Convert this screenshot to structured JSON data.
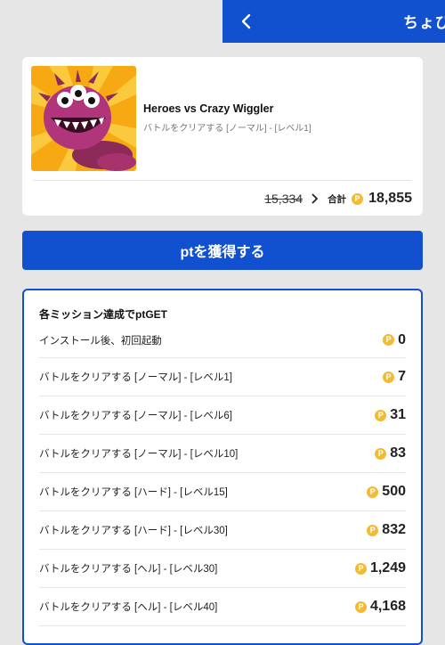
{
  "header": {
    "title": "ちょび"
  },
  "game": {
    "title": "Heroes vs Crazy Wiggler",
    "subtitle": "バトルをクリアする [ノーマル] - [レベル1]",
    "old_points": "15,334",
    "total_label": "合計",
    "coin_symbol": "P",
    "total_points": "18,855"
  },
  "cta": {
    "label": "ptを獲得する"
  },
  "missions": {
    "header": "各ミッション達成でptGET",
    "items": [
      {
        "label": "インストール後、初回起動",
        "points": "0"
      },
      {
        "label": "バトルをクリアする [ノーマル] - [レベル1]",
        "points": "7"
      },
      {
        "label": "バトルをクリアする [ノーマル] - [レベル6]",
        "points": "31"
      },
      {
        "label": "バトルをクリアする [ノーマル] - [レベル10]",
        "points": "83"
      },
      {
        "label": "バトルをクリアする [ハード] - [レベル15]",
        "points": "500"
      },
      {
        "label": "バトルをクリアする [ハード] - [レベル30]",
        "points": "832"
      },
      {
        "label": "バトルをクリアする [ヘル] - [レベル30]",
        "points": "1,249"
      },
      {
        "label": "バトルをクリアする [ヘル] - [レベル40]",
        "points": "4,168"
      }
    ]
  },
  "colors": {
    "primary": "#1150cf",
    "coin": "#f1bb34",
    "background": "#e6e6e6"
  },
  "icons": {
    "back": "chevron-left-icon",
    "arrow": "chevron-right-icon",
    "coin": "point-coin-icon"
  }
}
